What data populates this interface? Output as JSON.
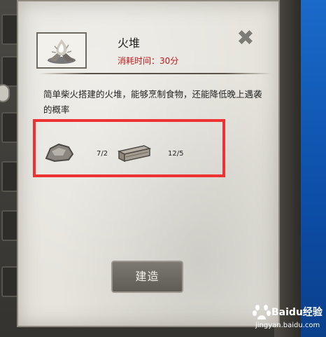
{
  "dialog": {
    "title": "火堆",
    "subtitle": "消耗时间：30分",
    "description": "简单柴火搭建的火堆，能够烹制食物，还能降低晚上遇袭的概率",
    "close_icon": "close-icon",
    "item_icon": "campfire-icon"
  },
  "resources": [
    {
      "icon": "stone-icon",
      "count": "7/2"
    },
    {
      "icon": "wood-planks-icon",
      "count": "12/5"
    }
  ],
  "actions": {
    "build_label": "建造"
  },
  "watermark": {
    "brand": "Baidu经验",
    "url": "jingyan.baidu.com"
  },
  "colors": {
    "highlight": "#ee3232",
    "subtitle": "#c0181b",
    "panel": "#e6e4dd"
  }
}
